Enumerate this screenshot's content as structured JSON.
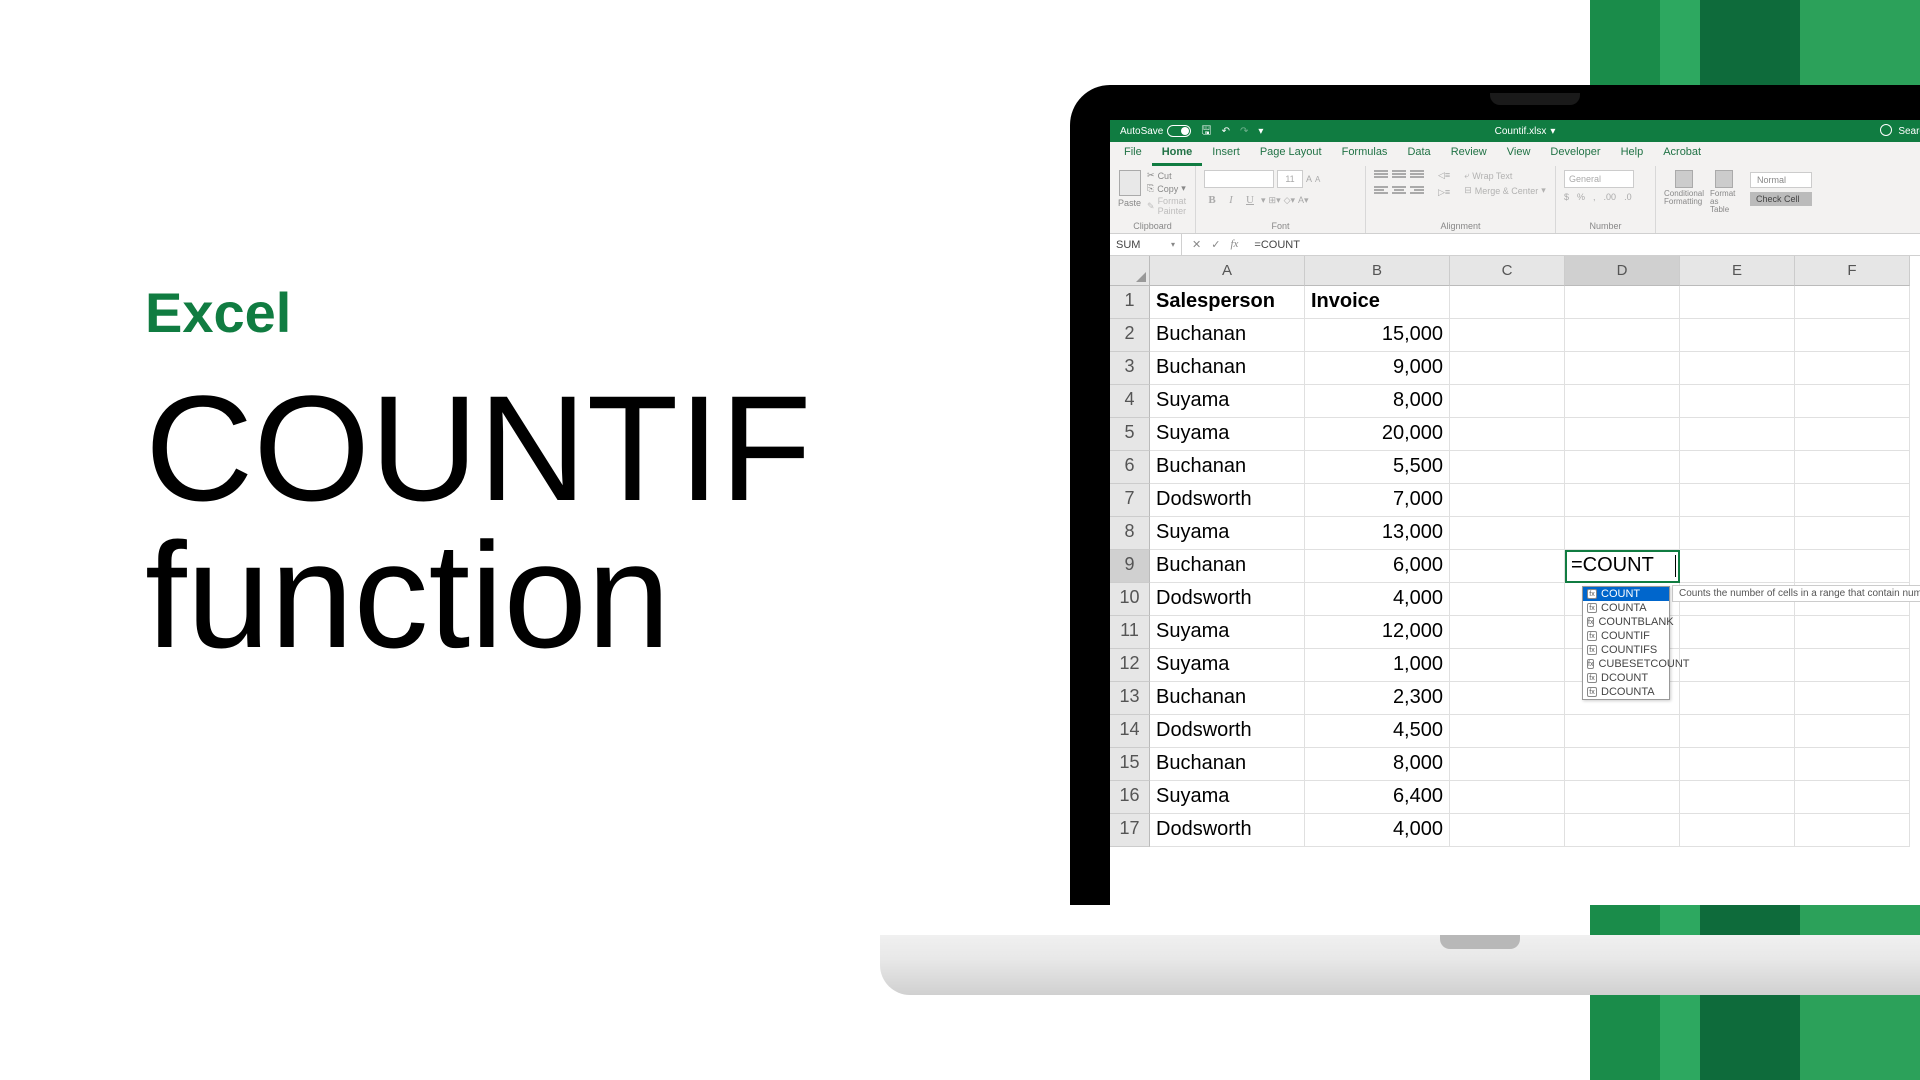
{
  "hero": {
    "brand": "Excel",
    "title_line1": "COUNTIF",
    "title_line2": "function"
  },
  "titlebar": {
    "autosave": "AutoSave",
    "filename": "Countif.xlsx",
    "search": "Search"
  },
  "tabs": [
    "File",
    "Home",
    "Insert",
    "Page Layout",
    "Formulas",
    "Data",
    "Review",
    "View",
    "Developer",
    "Help",
    "Acrobat"
  ],
  "ribbon": {
    "clipboard_title": "Clipboard",
    "cut": "Cut",
    "copy": "Copy",
    "format_painter": "Format Painter",
    "paste": "Paste",
    "font_title": "Font",
    "font_size": "11",
    "alignment_title": "Alignment",
    "wrap_text": "Wrap Text",
    "merge_center": "Merge & Center",
    "number_title": "Number",
    "number_format": "General",
    "cond_fmt": "Conditional Formatting",
    "fmt_table": "Format as Table",
    "normal": "Normal",
    "check_cell": "Check Cell"
  },
  "formula_bar": {
    "name": "SUM",
    "formula": "=COUNT"
  },
  "columns": [
    "A",
    "B",
    "C",
    "D",
    "E",
    "F"
  ],
  "headers": {
    "a": "Salesperson",
    "b": "Invoice"
  },
  "rows": [
    {
      "n": "2",
      "a": "Buchanan",
      "b": "15,000"
    },
    {
      "n": "3",
      "a": "Buchanan",
      "b": "9,000"
    },
    {
      "n": "4",
      "a": "Suyama",
      "b": "8,000"
    },
    {
      "n": "5",
      "a": "Suyama",
      "b": "20,000"
    },
    {
      "n": "6",
      "a": "Buchanan",
      "b": "5,500"
    },
    {
      "n": "7",
      "a": "Dodsworth",
      "b": "7,000"
    },
    {
      "n": "8",
      "a": "Suyama",
      "b": "13,000"
    },
    {
      "n": "9",
      "a": "Buchanan",
      "b": "6,000"
    },
    {
      "n": "10",
      "a": "Dodsworth",
      "b": "4,000"
    },
    {
      "n": "11",
      "a": "Suyama",
      "b": "12,000"
    },
    {
      "n": "12",
      "a": "Suyama",
      "b": "1,000"
    },
    {
      "n": "13",
      "a": "Buchanan",
      "b": "2,300"
    },
    {
      "n": "14",
      "a": "Dodsworth",
      "b": "4,500"
    },
    {
      "n": "15",
      "a": "Buchanan",
      "b": "8,000"
    },
    {
      "n": "16",
      "a": "Suyama",
      "b": "6,400"
    },
    {
      "n": "17",
      "a": "Dodsworth",
      "b": "4,000"
    }
  ],
  "editing_cell": "=COUNT",
  "autocomplete": {
    "items": [
      "COUNT",
      "COUNTA",
      "COUNTBLANK",
      "COUNTIF",
      "COUNTIFS",
      "CUBESETCOUNT",
      "DCOUNT",
      "DCOUNTA"
    ],
    "tooltip": "Counts the number of cells in a range that contain numbers"
  }
}
